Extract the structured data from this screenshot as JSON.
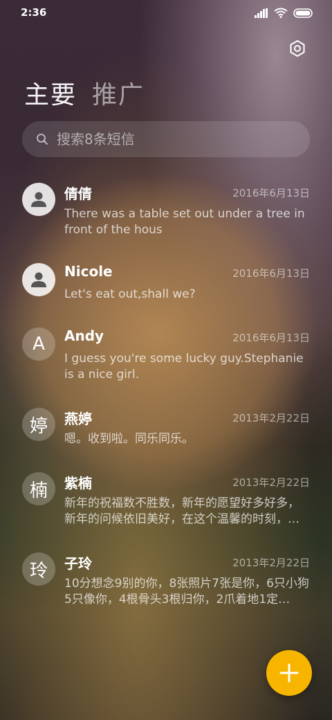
{
  "status_bar": {
    "time": "2:36",
    "icons": [
      "signal-icon",
      "wifi-icon",
      "battery-icon"
    ]
  },
  "header": {
    "settings_icon": "settings-icon",
    "tabs": [
      {
        "label": "主要",
        "active": true
      },
      {
        "label": "推广",
        "active": false
      }
    ]
  },
  "search": {
    "placeholder": "搜索8条短信"
  },
  "conversations": [
    {
      "avatar_type": "person-icon",
      "avatar_text": "",
      "name": "倩倩",
      "date": "2016年6月13日",
      "preview": "There was a table set out under a tree in front of the hous"
    },
    {
      "avatar_type": "person-icon",
      "avatar_text": "",
      "name": "Nicole",
      "date": "2016年6月13日",
      "preview": "Let's eat out,shall we?"
    },
    {
      "avatar_type": "letter",
      "avatar_text": "A",
      "name": "Andy",
      "date": "2016年6月13日",
      "preview": "I guess you're some lucky guy.Stephanie is a nice girl."
    },
    {
      "avatar_type": "letter",
      "avatar_text": "婷",
      "name": "燕婷",
      "date": "2013年2月22日",
      "preview": "嗯。收到啦。同乐同乐。"
    },
    {
      "avatar_type": "letter",
      "avatar_text": "楠",
      "name": "紫楠",
      "date": "2013年2月22日",
      "preview": "新年的祝福数不胜数，新年的愿望好多好多，新年的问候依旧美好，在这个温馨的时刻，…"
    },
    {
      "avatar_type": "letter",
      "avatar_text": "玲",
      "name": "子玲",
      "date": "2013年2月22日",
      "preview": "10分想念9别的你，8张照片7张是你，6只小狗5只像你，4根骨头3根归你，2爪着地1定…"
    }
  ],
  "fab": {
    "icon": "plus-icon",
    "color": "#f7b500"
  }
}
